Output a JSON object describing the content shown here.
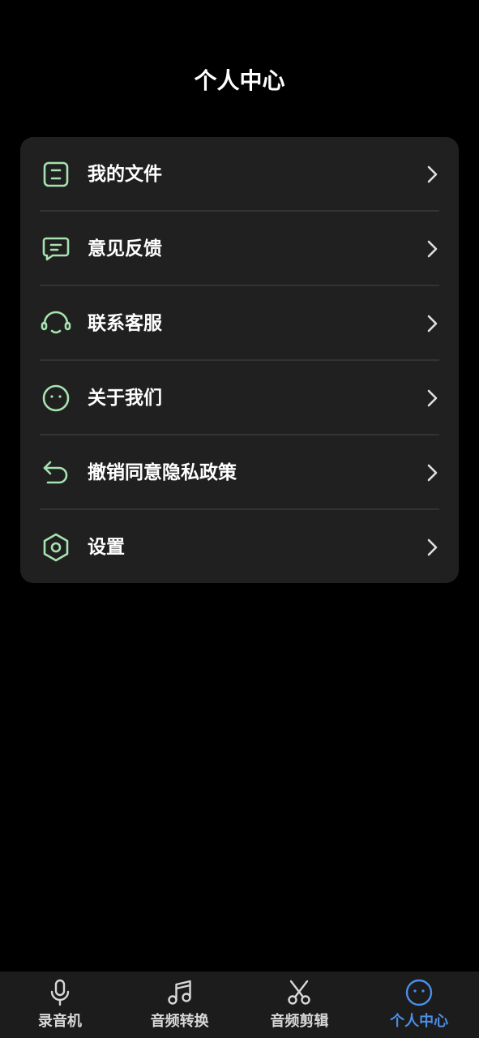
{
  "header": {
    "title": "个人中心"
  },
  "menu": {
    "items": [
      {
        "label": "我的文件",
        "icon": "file-icon"
      },
      {
        "label": "意见反馈",
        "icon": "chat-icon"
      },
      {
        "label": "联系客服",
        "icon": "headset-icon"
      },
      {
        "label": "关于我们",
        "icon": "face-icon"
      },
      {
        "label": "撤销同意隐私政策",
        "icon": "undo-icon"
      },
      {
        "label": "设置",
        "icon": "settings-icon"
      }
    ]
  },
  "tabbar": {
    "tabs": [
      {
        "label": "录音机",
        "icon": "microphone-icon",
        "active": false
      },
      {
        "label": "音频转换",
        "icon": "music-note-icon",
        "active": false
      },
      {
        "label": "音频剪辑",
        "icon": "scissors-icon",
        "active": false
      },
      {
        "label": "个人中心",
        "icon": "face-icon",
        "active": true
      }
    ]
  },
  "colors": {
    "background": "#000000",
    "card": "#202020",
    "icon_accent": "#a6e3b0",
    "tab_active": "#4a8fe8",
    "tab_inactive": "#d8d8d8"
  }
}
